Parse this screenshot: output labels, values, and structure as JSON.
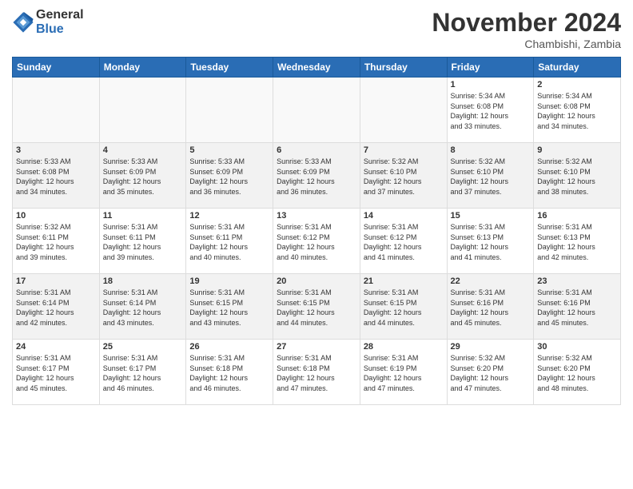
{
  "logo": {
    "general": "General",
    "blue": "Blue"
  },
  "header": {
    "title": "November 2024",
    "subtitle": "Chambishi, Zambia"
  },
  "weekdays": [
    "Sunday",
    "Monday",
    "Tuesday",
    "Wednesday",
    "Thursday",
    "Friday",
    "Saturday"
  ],
  "weeks": [
    [
      {
        "day": "",
        "info": "",
        "empty": true
      },
      {
        "day": "",
        "info": "",
        "empty": true
      },
      {
        "day": "",
        "info": "",
        "empty": true
      },
      {
        "day": "",
        "info": "",
        "empty": true
      },
      {
        "day": "",
        "info": "",
        "empty": true
      },
      {
        "day": "1",
        "info": "Sunrise: 5:34 AM\nSunset: 6:08 PM\nDaylight: 12 hours\nand 33 minutes."
      },
      {
        "day": "2",
        "info": "Sunrise: 5:34 AM\nSunset: 6:08 PM\nDaylight: 12 hours\nand 34 minutes."
      }
    ],
    [
      {
        "day": "3",
        "info": "Sunrise: 5:33 AM\nSunset: 6:08 PM\nDaylight: 12 hours\nand 34 minutes."
      },
      {
        "day": "4",
        "info": "Sunrise: 5:33 AM\nSunset: 6:09 PM\nDaylight: 12 hours\nand 35 minutes."
      },
      {
        "day": "5",
        "info": "Sunrise: 5:33 AM\nSunset: 6:09 PM\nDaylight: 12 hours\nand 36 minutes."
      },
      {
        "day": "6",
        "info": "Sunrise: 5:33 AM\nSunset: 6:09 PM\nDaylight: 12 hours\nand 36 minutes."
      },
      {
        "day": "7",
        "info": "Sunrise: 5:32 AM\nSunset: 6:10 PM\nDaylight: 12 hours\nand 37 minutes."
      },
      {
        "day": "8",
        "info": "Sunrise: 5:32 AM\nSunset: 6:10 PM\nDaylight: 12 hours\nand 37 minutes."
      },
      {
        "day": "9",
        "info": "Sunrise: 5:32 AM\nSunset: 6:10 PM\nDaylight: 12 hours\nand 38 minutes."
      }
    ],
    [
      {
        "day": "10",
        "info": "Sunrise: 5:32 AM\nSunset: 6:11 PM\nDaylight: 12 hours\nand 39 minutes."
      },
      {
        "day": "11",
        "info": "Sunrise: 5:31 AM\nSunset: 6:11 PM\nDaylight: 12 hours\nand 39 minutes."
      },
      {
        "day": "12",
        "info": "Sunrise: 5:31 AM\nSunset: 6:11 PM\nDaylight: 12 hours\nand 40 minutes."
      },
      {
        "day": "13",
        "info": "Sunrise: 5:31 AM\nSunset: 6:12 PM\nDaylight: 12 hours\nand 40 minutes."
      },
      {
        "day": "14",
        "info": "Sunrise: 5:31 AM\nSunset: 6:12 PM\nDaylight: 12 hours\nand 41 minutes."
      },
      {
        "day": "15",
        "info": "Sunrise: 5:31 AM\nSunset: 6:13 PM\nDaylight: 12 hours\nand 41 minutes."
      },
      {
        "day": "16",
        "info": "Sunrise: 5:31 AM\nSunset: 6:13 PM\nDaylight: 12 hours\nand 42 minutes."
      }
    ],
    [
      {
        "day": "17",
        "info": "Sunrise: 5:31 AM\nSunset: 6:14 PM\nDaylight: 12 hours\nand 42 minutes."
      },
      {
        "day": "18",
        "info": "Sunrise: 5:31 AM\nSunset: 6:14 PM\nDaylight: 12 hours\nand 43 minutes."
      },
      {
        "day": "19",
        "info": "Sunrise: 5:31 AM\nSunset: 6:15 PM\nDaylight: 12 hours\nand 43 minutes."
      },
      {
        "day": "20",
        "info": "Sunrise: 5:31 AM\nSunset: 6:15 PM\nDaylight: 12 hours\nand 44 minutes."
      },
      {
        "day": "21",
        "info": "Sunrise: 5:31 AM\nSunset: 6:15 PM\nDaylight: 12 hours\nand 44 minutes."
      },
      {
        "day": "22",
        "info": "Sunrise: 5:31 AM\nSunset: 6:16 PM\nDaylight: 12 hours\nand 45 minutes."
      },
      {
        "day": "23",
        "info": "Sunrise: 5:31 AM\nSunset: 6:16 PM\nDaylight: 12 hours\nand 45 minutes."
      }
    ],
    [
      {
        "day": "24",
        "info": "Sunrise: 5:31 AM\nSunset: 6:17 PM\nDaylight: 12 hours\nand 45 minutes."
      },
      {
        "day": "25",
        "info": "Sunrise: 5:31 AM\nSunset: 6:17 PM\nDaylight: 12 hours\nand 46 minutes."
      },
      {
        "day": "26",
        "info": "Sunrise: 5:31 AM\nSunset: 6:18 PM\nDaylight: 12 hours\nand 46 minutes."
      },
      {
        "day": "27",
        "info": "Sunrise: 5:31 AM\nSunset: 6:18 PM\nDaylight: 12 hours\nand 47 minutes."
      },
      {
        "day": "28",
        "info": "Sunrise: 5:31 AM\nSunset: 6:19 PM\nDaylight: 12 hours\nand 47 minutes."
      },
      {
        "day": "29",
        "info": "Sunrise: 5:32 AM\nSunset: 6:20 PM\nDaylight: 12 hours\nand 47 minutes."
      },
      {
        "day": "30",
        "info": "Sunrise: 5:32 AM\nSunset: 6:20 PM\nDaylight: 12 hours\nand 48 minutes."
      }
    ]
  ]
}
